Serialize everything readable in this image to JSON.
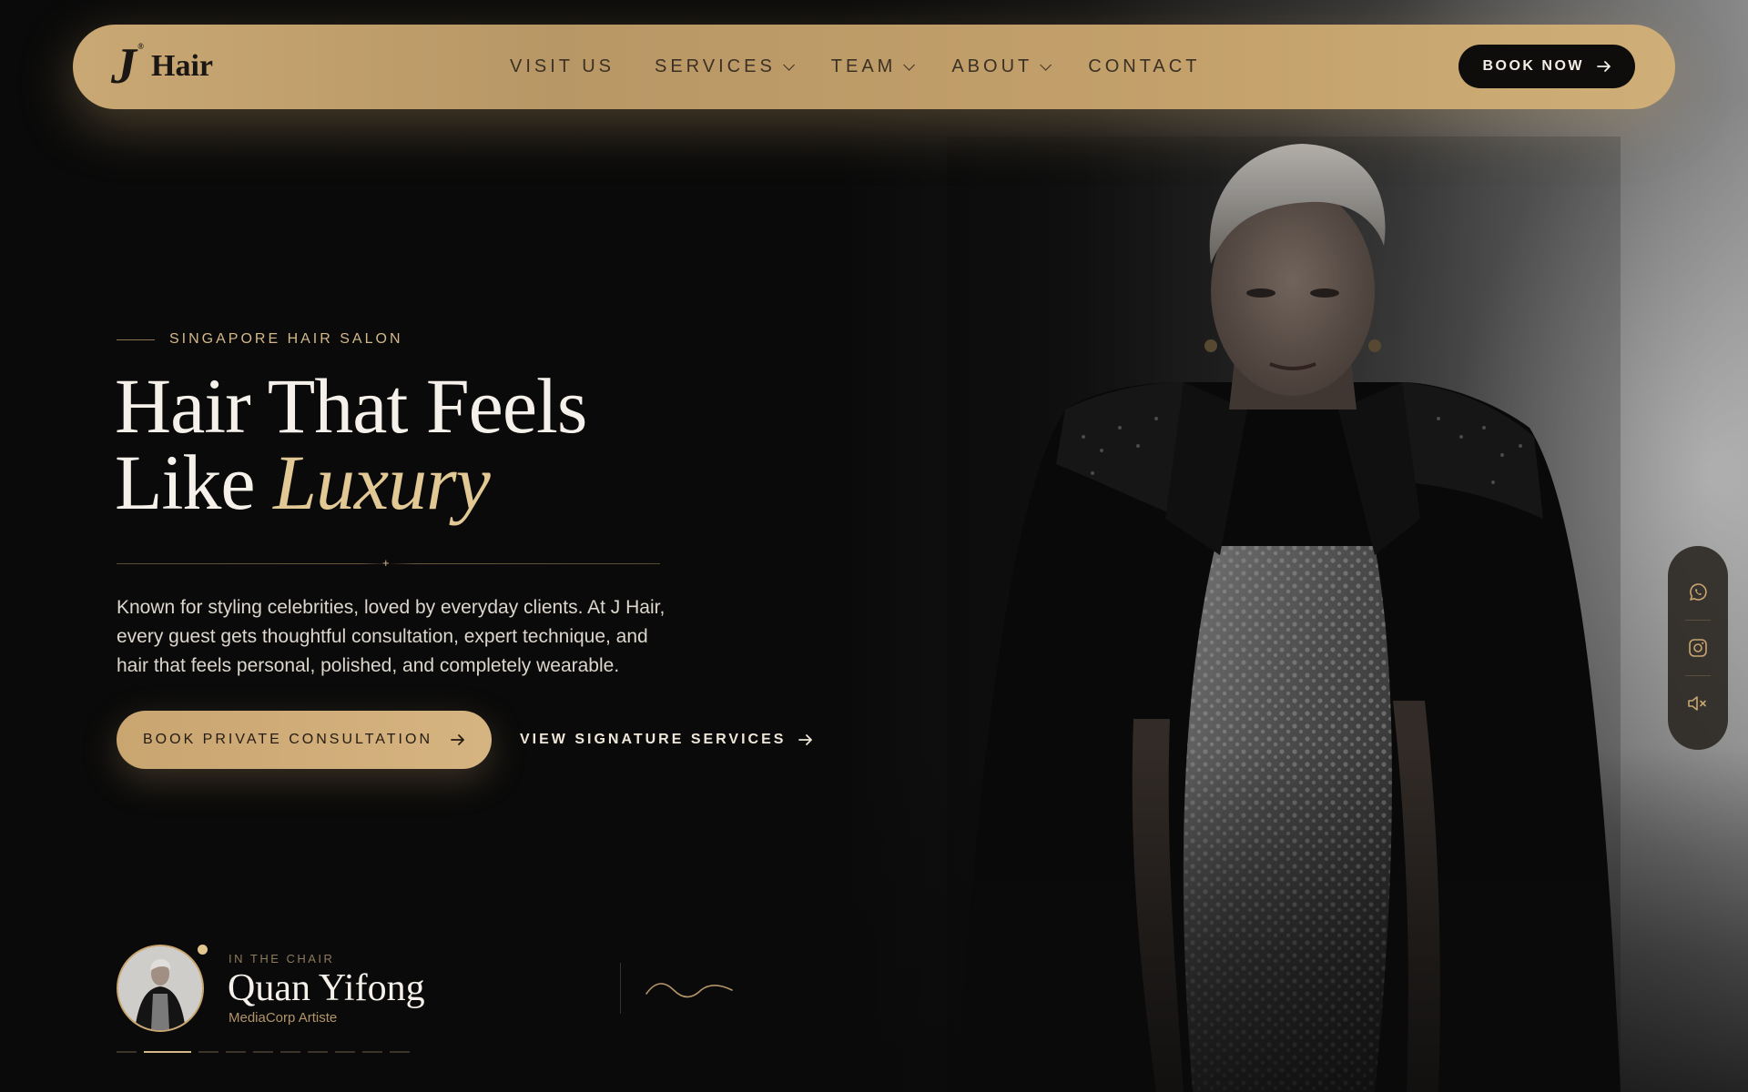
{
  "nav": {
    "logo_mark": "J",
    "logo_reg": "®",
    "logo_text": "Hair",
    "links": [
      {
        "label": "VISIT US",
        "has_dropdown": false
      },
      {
        "label": "SERVICES",
        "has_dropdown": true
      },
      {
        "label": "TEAM",
        "has_dropdown": true
      },
      {
        "label": "ABOUT",
        "has_dropdown": true
      },
      {
        "label": "CONTACT",
        "has_dropdown": false
      }
    ],
    "book_now": "BOOK NOW",
    "book_now_icon": "arrow-right-icon"
  },
  "hero": {
    "eyebrow": "SINGAPORE HAIR SALON",
    "headline_line1": "Hair That Feels",
    "headline_line2_plain": "Like ",
    "headline_line2_accent": "Luxury",
    "divider_glyph": "+",
    "description": "Known for styling celebrities, loved by everyday clients. At J Hair, every guest gets thoughtful consultation, expert technique, and hair that feels personal, polished, and completely wearable.",
    "primary_cta": "BOOK PRIVATE CONSULTATION",
    "secondary_cta": "VIEW SIGNATURE SERVICES"
  },
  "social": [
    {
      "icon": "whatsapp-icon"
    },
    {
      "icon": "instagram-icon"
    },
    {
      "icon": "sound-muted-icon"
    }
  ],
  "chair": {
    "label": "IN THE CHAIR",
    "name": "Quan Yifong",
    "role": "MediaCorp Artiste"
  },
  "slider": {
    "total": 10,
    "active_index": 1
  },
  "colors": {
    "gold": "#c9a570",
    "gold_light": "#e2c894",
    "dark": "#0b0b0b",
    "nav_text": "#3b3024"
  }
}
